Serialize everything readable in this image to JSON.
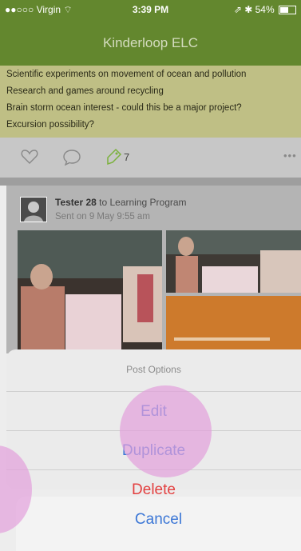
{
  "status_bar": {
    "carrier": "●●○○○ Virgin ⌔",
    "time": "3:39 PM",
    "right": "⇗ ✱ 54%"
  },
  "nav": {
    "title": "Kinderloop ELC"
  },
  "note": {
    "lines": [
      "Scientific experiments on movement of ocean and pollution",
      "Research and games around recycling",
      "Brain storm ocean interest - could this be a major project?",
      "Excursion possibility?"
    ]
  },
  "actions": {
    "tag_count": "7",
    "more": "•••"
  },
  "post": {
    "author": "Tester 28",
    "to_text": " to Learning Program",
    "sent": "Sent on 9 May 9:55 am"
  },
  "sheet": {
    "title": "Post Options",
    "edit": "Edit",
    "duplicate": "Duplicate",
    "delete": "Delete",
    "cancel": "Cancel"
  },
  "colors": {
    "brand": "#63872e",
    "accent": "#3c77d6",
    "danger": "#e34040",
    "note_bg": "#bfbf85",
    "highlight": "#e2a0dc"
  }
}
